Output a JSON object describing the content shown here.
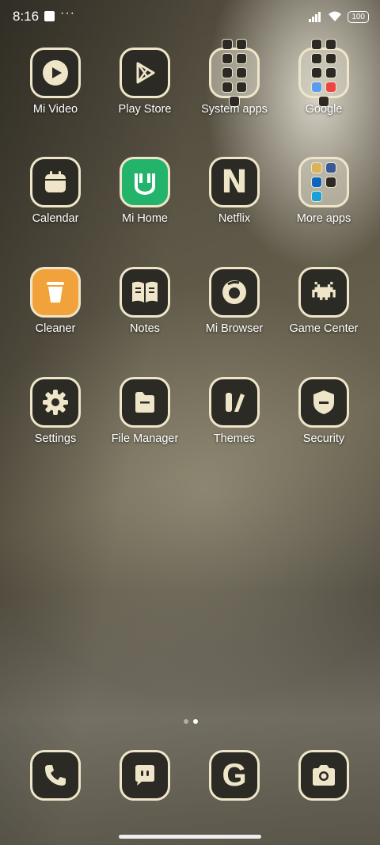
{
  "status": {
    "time": "8:16",
    "overflow": "···",
    "battery": "100"
  },
  "apps": [
    {
      "label": "Mi Video",
      "icon": "play-circle-icon"
    },
    {
      "label": "Play Store",
      "icon": "play-store-icon"
    },
    {
      "label": "System apps",
      "icon": "folder-icon"
    },
    {
      "label": "Google",
      "icon": "folder-icon"
    },
    {
      "label": "Calendar",
      "icon": "calendar-icon"
    },
    {
      "label": "Mi Home",
      "icon": "mi-home-icon"
    },
    {
      "label": "Netflix",
      "icon": "netflix-icon"
    },
    {
      "label": "More apps",
      "icon": "folder-icon"
    },
    {
      "label": "Cleaner",
      "icon": "trash-icon"
    },
    {
      "label": "Notes",
      "icon": "book-icon"
    },
    {
      "label": "Mi Browser",
      "icon": "browser-icon"
    },
    {
      "label": "Game Center",
      "icon": "space-invader-icon"
    },
    {
      "label": "Settings",
      "icon": "gear-icon"
    },
    {
      "label": "File Manager",
      "icon": "file-icon"
    },
    {
      "label": "Themes",
      "icon": "themes-icon"
    },
    {
      "label": "Security",
      "icon": "shield-icon"
    }
  ],
  "dock": [
    {
      "icon": "phone-icon"
    },
    {
      "icon": "message-icon"
    },
    {
      "icon": "google-icon",
      "glyph": "G"
    },
    {
      "icon": "camera-icon"
    }
  ],
  "netflix_glyph": "N",
  "colors": {
    "tile": "#2b2a24",
    "tile_border": "#efe6c9",
    "mi_home": "#24b36b",
    "cleaner": "#f2a23a"
  }
}
